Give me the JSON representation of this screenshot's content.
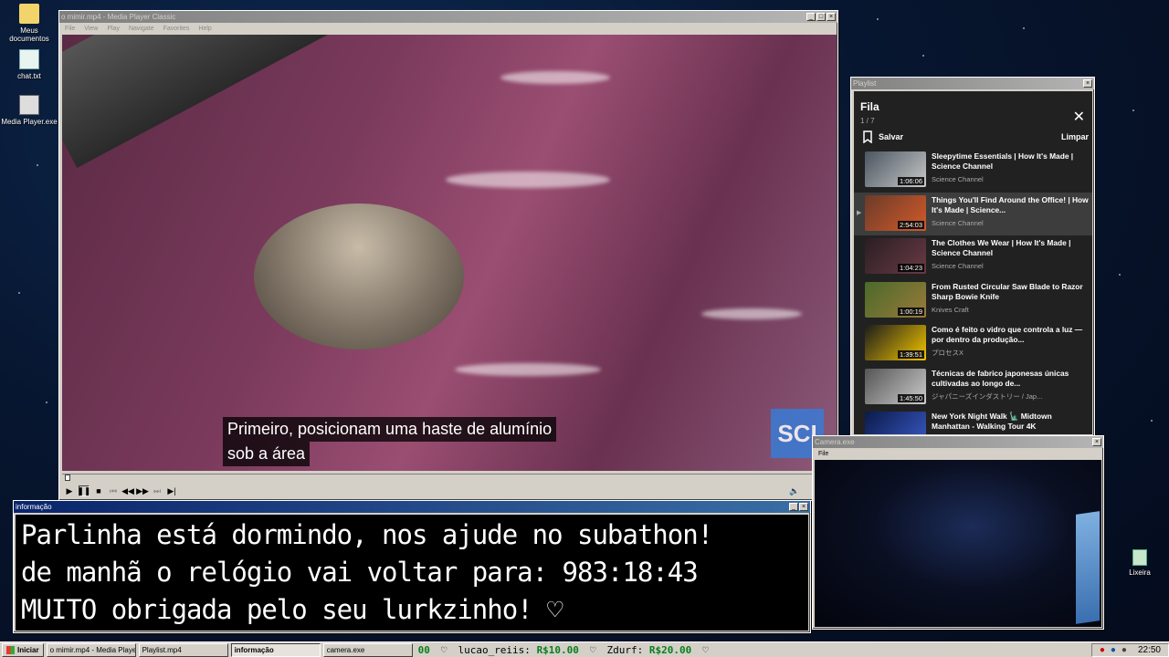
{
  "desktop": {
    "icons": [
      {
        "label": "Meus documentos",
        "icon": "folder-icon"
      },
      {
        "label": "chat.txt",
        "icon": "notepad-icon"
      },
      {
        "label": "Media Player.exe",
        "icon": "media-player-icon"
      },
      {
        "label": "Lixeira",
        "icon": "recycle-bin-icon"
      }
    ]
  },
  "player": {
    "title": "o mimir.mp4 - Media Player Classic",
    "menu": [
      "File",
      "View",
      "Play",
      "Navigate",
      "Favorites",
      "Help"
    ],
    "subtitle_line1": "Primeiro, posicionam uma haste de alumínio",
    "subtitle_line2": "sob a área",
    "logo": "SCI",
    "progress": 0.004
  },
  "playlist_window": {
    "title": "Playlist",
    "header": "Fila",
    "count": "1 / 7",
    "save_label": "Salvar",
    "clear_label": "Limpar",
    "items": [
      {
        "title": "Sleepytime Essentials | How It's Made | Science Channel",
        "channel": "Science Channel",
        "duration": "1:06:06",
        "current": false
      },
      {
        "title": "Things You'll Find Around the Office! | How It's Made | Science...",
        "channel": "Science Channel",
        "duration": "2:54:03",
        "current": true
      },
      {
        "title": "The Clothes We Wear | How It's Made | Science Channel",
        "channel": "Science Channel",
        "duration": "1:04:23",
        "current": false
      },
      {
        "title": "From Rusted Circular Saw Blade to Razor Sharp Bowie Knife",
        "channel": "Knives Craft",
        "duration": "1:00:19",
        "current": false
      },
      {
        "title": "Como é feito o vidro que controla a luz — por dentro da produção...",
        "channel": "プロセスX",
        "duration": "1:39:51",
        "current": false
      },
      {
        "title": "Técnicas de fabrico japonesas únicas cultivadas ao longo de...",
        "channel": "ジャパニーズインダストリー / Jap...",
        "duration": "1:45:50",
        "current": false
      },
      {
        "title": "New York Night Walk 🗽 Midtown Manhattan - Walking Tour 4K",
        "channel": "",
        "duration": "",
        "current": false
      }
    ]
  },
  "info_window": {
    "title": "informação",
    "line1": "Parlinha está dormindo, nos ajude no subathon!",
    "line2": "de manhã o relógio vai voltar para:  983:18:43",
    "line3": "MUITO obrigada pelo seu lurkzinho! ♡"
  },
  "camera_window": {
    "title": "Camera.exe",
    "menu": "File"
  },
  "taskbar": {
    "start": "Iniciar",
    "tasks": [
      {
        "label": "o mimir.mp4 - Media Playe...",
        "active": false
      },
      {
        "label": "Playlist.mp4",
        "active": false
      },
      {
        "label": "informação",
        "active": true
      },
      {
        "label": "camera.exe",
        "active": false
      }
    ],
    "ticker": [
      {
        "name": "00",
        "amount": ""
      },
      {
        "name": "lucao_reiis:",
        "amount": "R$10.00"
      },
      {
        "name": "Zdurf:",
        "amount": "R$20.00"
      }
    ],
    "clock": "22:50"
  }
}
